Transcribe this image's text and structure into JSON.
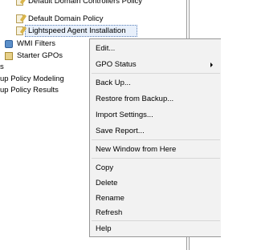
{
  "tree": {
    "items": [
      {
        "label": "Default Domain Controllers Policy",
        "icon": "gpo-link-icon"
      },
      {
        "label": "Default Domain Policy",
        "icon": "gpo-link-icon"
      },
      {
        "label": "Lightspeed Agent Installation",
        "icon": "gpo-link-icon",
        "selected": true
      },
      {
        "label": "WMI Filters",
        "icon": "wmi-filter-icon"
      },
      {
        "label": "Starter GPOs",
        "icon": "starter-gpo-icon"
      },
      {
        "label": "s"
      },
      {
        "label": "up Policy Modeling"
      },
      {
        "label": "up Policy Results"
      }
    ]
  },
  "context_menu": {
    "items": [
      {
        "label": "Edit..."
      },
      {
        "label": "GPO Status",
        "submenu": true
      },
      {
        "label": "Back Up..."
      },
      {
        "label": "Restore from Backup..."
      },
      {
        "label": "Import Settings..."
      },
      {
        "label": "Save Report..."
      },
      {
        "label": "New Window from Here"
      },
      {
        "label": "Copy"
      },
      {
        "label": "Delete"
      },
      {
        "label": "Rename"
      },
      {
        "label": "Refresh"
      },
      {
        "label": "Help"
      }
    ]
  }
}
